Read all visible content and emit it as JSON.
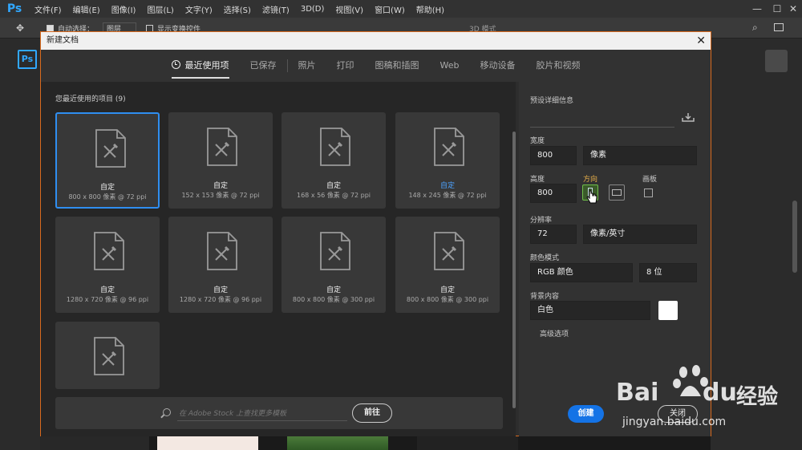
{
  "app": {
    "logo": "Ps",
    "menus": [
      "文件(F)",
      "编辑(E)",
      "图像(I)",
      "图层(L)",
      "文字(Y)",
      "选择(S)",
      "滤镜(T)",
      "3D(D)",
      "视图(V)",
      "窗口(W)",
      "帮助(H)"
    ],
    "options": {
      "auto_select": "自动选择：",
      "layer": "图层",
      "show_transform": "显示变换控件",
      "mode_3d": "3D 模式"
    }
  },
  "dialog": {
    "title": "新建文档",
    "tabs": [
      {
        "label": "最近使用项",
        "active": true
      },
      {
        "label": "已保存"
      },
      {
        "label": "照片"
      },
      {
        "label": "打印"
      },
      {
        "label": "图稿和插图"
      },
      {
        "label": "Web"
      },
      {
        "label": "移动设备"
      },
      {
        "label": "胶片和视频"
      }
    ],
    "recent": {
      "header": "您最近使用的项目",
      "count": "(9)",
      "items": [
        {
          "name": "自定",
          "desc": "800 x 800 像素 @ 72 ppi",
          "selected": true
        },
        {
          "name": "自定",
          "desc": "152 x 153 像素 @ 72 ppi"
        },
        {
          "name": "自定",
          "desc": "168 x 56 像素 @ 72 ppi"
        },
        {
          "name": "自定",
          "desc": "148 x 245 像素 @ 72 ppi",
          "highlight": true
        },
        {
          "name": "自定",
          "desc": "1280 x 720 像素 @ 96 ppi"
        },
        {
          "name": "自定",
          "desc": "1280 x 720 像素 @ 96 ppi"
        },
        {
          "name": "自定",
          "desc": "800 x 800 像素 @ 300 ppi"
        },
        {
          "name": "自定",
          "desc": "800 x 800 像素 @ 300 ppi"
        },
        {
          "name": "",
          "desc": ""
        }
      ]
    },
    "search": {
      "placeholder": "在 Adobe Stock 上查找更多模板",
      "button": "前往"
    },
    "details": {
      "header": "预设详细信息",
      "width_label": "宽度",
      "width_value": "800",
      "width_unit": "像素",
      "height_label": "高度",
      "height_value": "800",
      "orientation_label": "方向",
      "artboard_label": "画板",
      "resolution_label": "分辨率",
      "resolution_value": "72",
      "resolution_unit": "像素/英寸",
      "color_mode_label": "颜色模式",
      "color_mode_value": "RGB 颜色",
      "bit_depth": "8 位",
      "background_label": "背景内容",
      "background_value": "白色",
      "background_swatch": "#ffffff",
      "advanced": "高级选项"
    },
    "buttons": {
      "create": "创建",
      "close": "关闭"
    }
  },
  "watermark": {
    "brand": "Bai",
    "brand2": "du",
    "cn": "经验",
    "url": "jingyan.baidu.com"
  },
  "colors": {
    "accent": "#1473e6",
    "selection": "#2f8ef0",
    "dialog_border": "#d96a1e",
    "ps_blue": "#31a8ff"
  }
}
